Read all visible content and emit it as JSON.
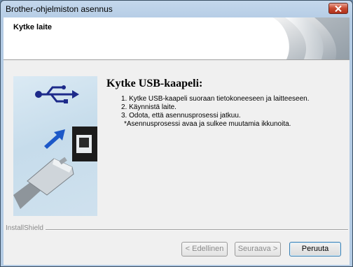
{
  "window": {
    "title": "Brother-ohjelmiston asennus"
  },
  "header": {
    "title": "Kytke laite"
  },
  "content": {
    "heading": "Kytke USB-kaapeli:",
    "steps": [
      "1. Kytke USB-kaapeli suoraan tietokoneeseen ja laitteeseen.",
      "2. Käynnistä laite.",
      "3. Odota, että asennusprosessi jatkuu."
    ],
    "note": "*Asennusprosessi avaa ja sulkee muutamia ikkunoita."
  },
  "footer": {
    "installshield_label": "InstallShield"
  },
  "buttons": {
    "back": "< Edellinen",
    "next": "Seuraava >",
    "cancel": "Peruuta"
  }
}
